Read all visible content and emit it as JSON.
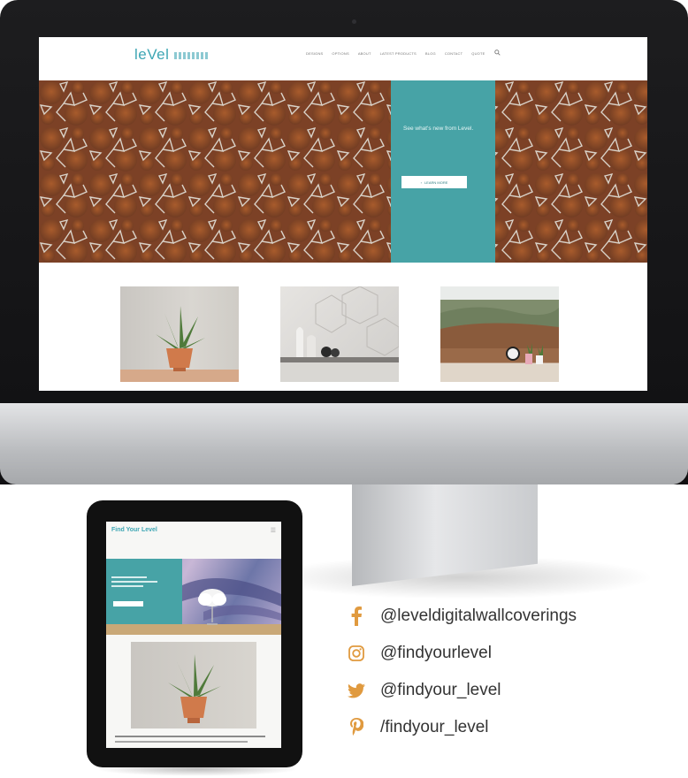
{
  "desktop_site": {
    "logo": "leVel",
    "nav_items": [
      "DESIGNS",
      "OPTIONS",
      "ABOUT",
      "LATEST PRODUCTS",
      "BLOG",
      "CONTACT",
      "QUOTE"
    ],
    "hero_text": "See what's new from Level.",
    "hero_button": "LEARN MORE"
  },
  "tablet_site": {
    "title": "Find Your Level",
    "menu_icon": "☰"
  },
  "social": [
    {
      "icon": "facebook-icon",
      "glyph": "f",
      "handle": "@leveldigitalwallcoverings"
    },
    {
      "icon": "instagram-icon",
      "glyph": "",
      "handle": "@findyourlevel"
    },
    {
      "icon": "twitter-icon",
      "glyph": "",
      "handle": "@findyour_level"
    },
    {
      "icon": "pinterest-icon",
      "glyph": "",
      "handle": "/findyour_level"
    }
  ],
  "colors": {
    "accent_teal": "#47a3a6",
    "logo_teal": "#3ea6b4",
    "social_icon": "#e09a3f",
    "hero_copper": "#8a4b2a"
  }
}
